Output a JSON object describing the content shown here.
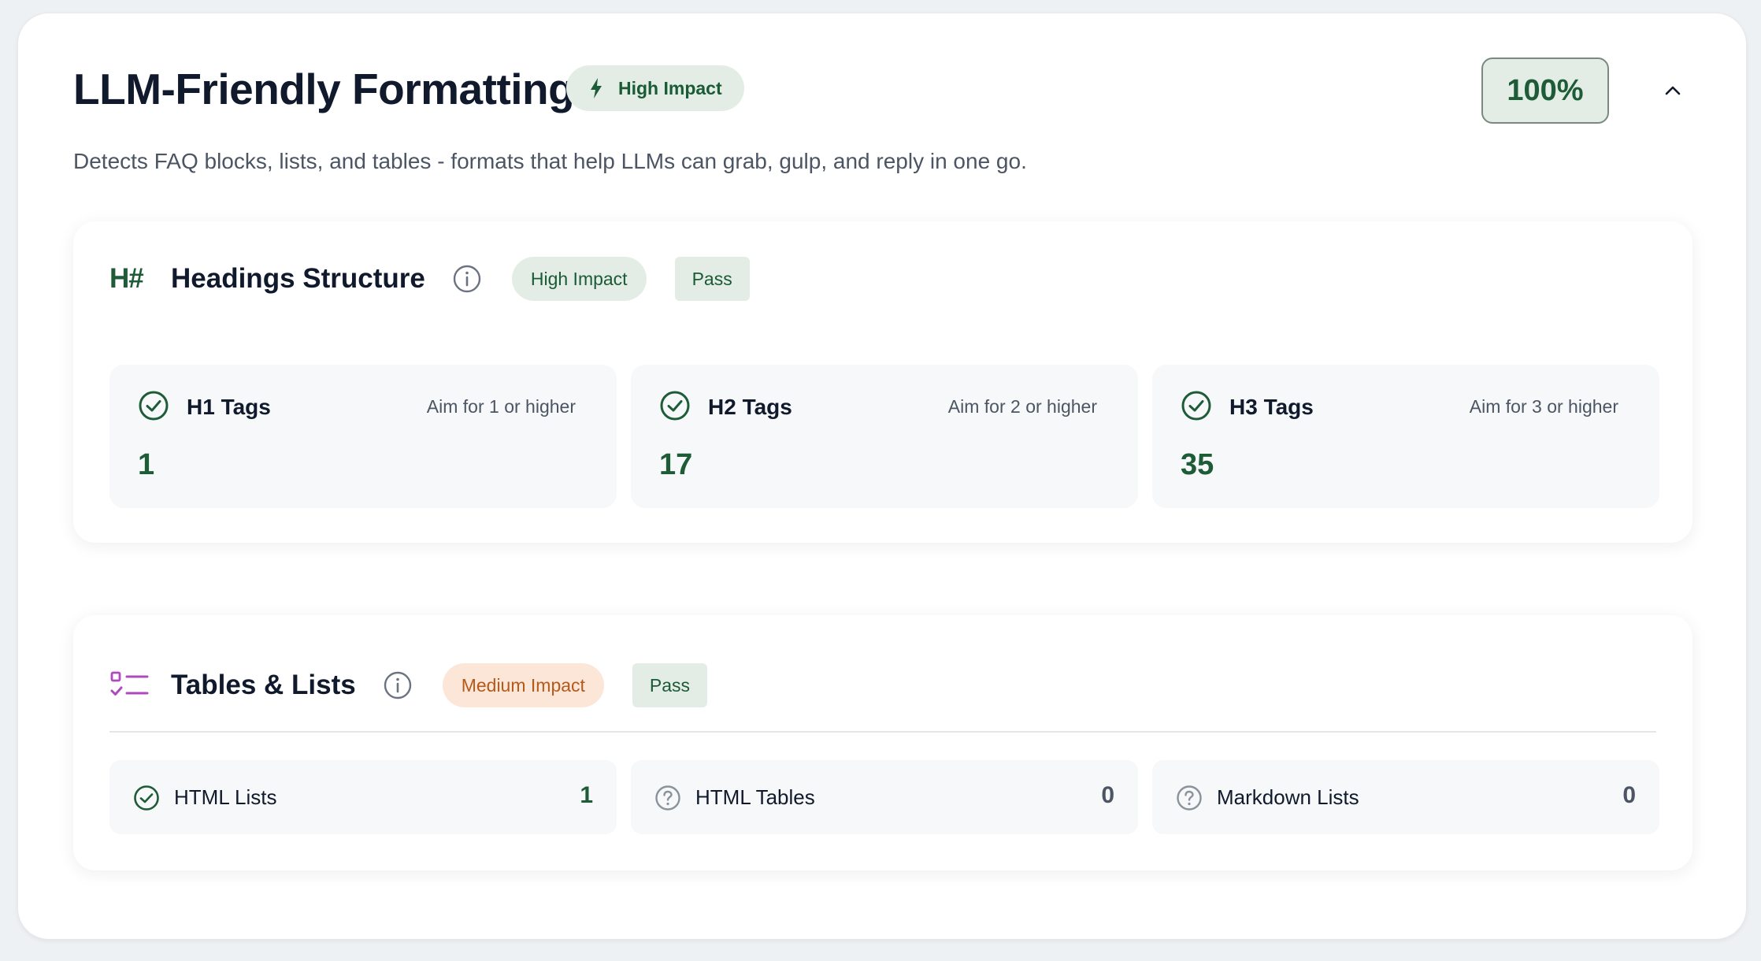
{
  "header": {
    "title": "LLM-Friendly Formatting",
    "impact_label": "High Impact",
    "score": "100%",
    "description": "Detects FAQ blocks, lists, and tables - formats that help LLMs can grab, gulp, and reply in one go."
  },
  "headings_section": {
    "icon_text": "H#",
    "title": "Headings Structure",
    "impact": "High Impact",
    "status": "Pass",
    "cards": [
      {
        "name": "H1 Tags",
        "aim": "Aim for 1 or higher",
        "value": "1"
      },
      {
        "name": "H2 Tags",
        "aim": "Aim for 2 or higher",
        "value": "17"
      },
      {
        "name": "H3 Tags",
        "aim": "Aim for 3 or higher",
        "value": "35"
      }
    ]
  },
  "tables_section": {
    "title": "Tables & Lists",
    "impact": "Medium Impact",
    "status": "Pass",
    "items": [
      {
        "label": "HTML Lists",
        "value": "1",
        "state": "check"
      },
      {
        "label": "HTML Tables",
        "value": "0",
        "state": "question"
      },
      {
        "label": "Markdown Lists",
        "value": "0",
        "state": "question"
      }
    ]
  },
  "colors": {
    "accent_green": "#1d5c37",
    "badge_green_bg": "#e3ede6",
    "medium_bg": "#fbe6d8",
    "medium_text": "#b45a1b",
    "list_icon_purple": "#b048c0"
  }
}
